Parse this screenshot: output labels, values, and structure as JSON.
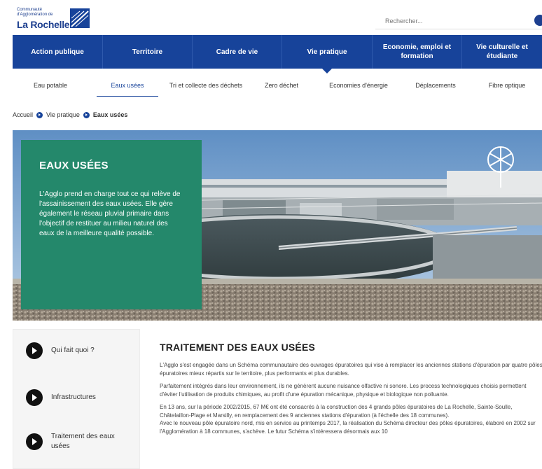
{
  "header": {
    "logo_line1": "Communauté",
    "logo_line2": "d'Agglomération de",
    "logo_line3": "La Rochelle",
    "search_placeholder": "Rechercher..."
  },
  "main_nav": [
    {
      "label": "Action publique"
    },
    {
      "label": "Territoire"
    },
    {
      "label": "Cadre de vie"
    },
    {
      "label": "Vie pratique"
    },
    {
      "label": "Economie, emploi et formation"
    },
    {
      "label": "Vie culturelle et étudiante"
    }
  ],
  "sub_nav": [
    {
      "label": "Eau potable"
    },
    {
      "label": "Eaux usées"
    },
    {
      "label": "Tri et collecte des déchets"
    },
    {
      "label": "Zero déchet"
    },
    {
      "label": "Economies d'énergie"
    },
    {
      "label": "Déplacements"
    },
    {
      "label": "Fibre optique"
    }
  ],
  "breadcrumb": {
    "home": "Accueil",
    "section": "Vie pratique",
    "current": "Eaux usées"
  },
  "hero": {
    "title": "EAUX USÉES",
    "text": "L'Agglo prend en charge tout ce qui relève de l'assainissement des eaux usées. Elle gère également le réseau pluvial primaire dans l'objectif de restituer au milieu naturel des eaux de la meilleure qualité possible."
  },
  "side_menu": [
    {
      "label": "Qui fait quoi ?"
    },
    {
      "label": "Infrastructures"
    },
    {
      "label": "Traitement des eaux usées"
    }
  ],
  "content": {
    "title": "TRAITEMENT DES EAUX USÉES",
    "p1": "L'Agglo s'est engagée dans un Schéma communautaire des ouvrages épuratoires qui vise à remplacer les anciennes stations d'épuration par quatre pôles épuratoires mieux répartis sur le territoire, plus performants et plus durables.",
    "p2": "Parfaitement intégrés dans leur environnement, ils ne génèrent aucune nuisance olfactive ni sonore. Les process technologiques choisis permettent d'éviter l'utilisation de produits chimiques, au profit d'une épuration mécanique, physique et biologique non polluante.",
    "p3": "En 13 ans, sur la période 2002/2015, 67 M€ ont été consacrés à la construction des 4 grands pôles épuratoires de La Rochelle, Sainte-Soulle, Châtelaillon-Plage et Marsilly, en remplacement des 9 anciennes stations d'épuration (à l'échelle des 18 communes).",
    "p4": "Avec le nouveau pôle épuratoire nord, mis en service au printemps 2017, la réalisation du Schéma directeur des pôles épuratoires, élaboré en 2002 sur l'Agglomération à 18 communes, s'achève. Le futur Schéma s'intéressera désormais aux 10"
  },
  "colors": {
    "nav_blue": "#17439a",
    "hero_green": "#24886b"
  }
}
